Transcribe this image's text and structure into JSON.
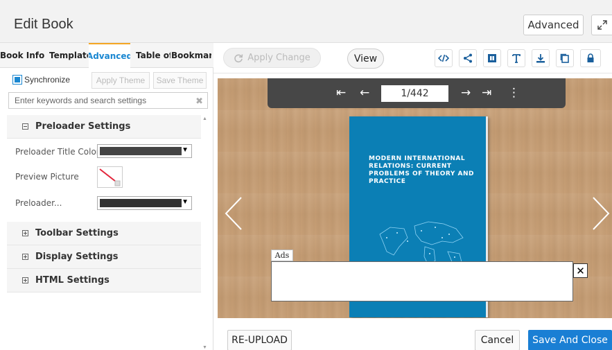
{
  "header": {
    "title": "Edit Book",
    "advanced_label": "Advanced"
  },
  "left_panel": {
    "tabs": [
      {
        "label": "Book Info"
      },
      {
        "label": "Template"
      },
      {
        "label": "Advanced",
        "active": true
      },
      {
        "label": "Table of"
      },
      {
        "label": "Bookmark"
      }
    ],
    "synchronize_label": "Synchronize",
    "synchronize_checked": true,
    "apply_theme_label": "Apply Theme",
    "save_theme_label": "Save Theme",
    "search": {
      "placeholder": "Enter keywords and search settings",
      "value": ""
    },
    "sections": [
      {
        "label": "Preloader Settings",
        "expanded": true,
        "properties": [
          {
            "label": "Preloader Title Color",
            "value": "#444444"
          },
          {
            "label": "Preview Picture"
          },
          {
            "label": "Preloader...",
            "value": "#333333"
          }
        ]
      },
      {
        "label": "Toolbar Settings",
        "expanded": false
      },
      {
        "label": "Display Settings",
        "expanded": false
      },
      {
        "label": "HTML Settings",
        "expanded": false
      }
    ]
  },
  "toolbar": {
    "apply_change_label": "Apply Change",
    "view_label": "View",
    "tools": [
      "embed-code-icon",
      "share-icon",
      "pages-icon",
      "text-icon",
      "download-icon",
      "copy-icon",
      "lock-icon"
    ]
  },
  "viewer": {
    "page_indicator": "1/442",
    "book_title": "MODERN INTERNATIONAL RELATIONS: CURRENT PROBLEMS OF THEORY AND PRACTICE",
    "ads_label": "Ads",
    "ads_close": "✕"
  },
  "footer": {
    "reupload_label": "RE-UPLOAD",
    "cancel_label": "Cancel",
    "save_close_label": "Save And Close"
  },
  "colors": {
    "accent_blue": "#1a7fd4",
    "tab_active_underline": "#f5a623",
    "book_cover": "#0b7fb5",
    "viewer_bar": "#474747"
  }
}
